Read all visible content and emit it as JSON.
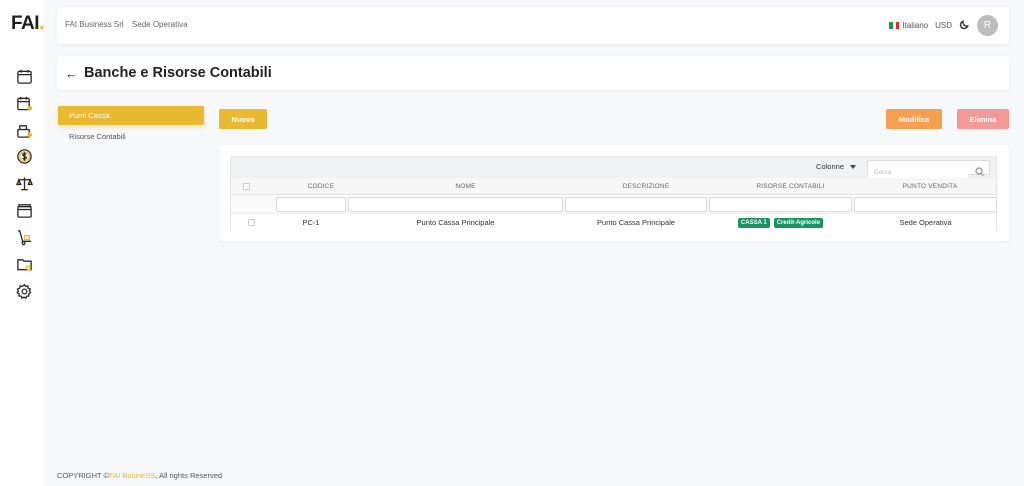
{
  "app": {
    "logo_text": "FAI",
    "logo_dot": ".",
    "brand_color": "#e8b931"
  },
  "sidebar": {
    "icons": [
      {
        "name": "calendar-icon"
      },
      {
        "name": "calendar-alert-icon"
      },
      {
        "name": "cash-register-icon"
      },
      {
        "name": "dollar-coin-icon"
      },
      {
        "name": "scale-icon"
      },
      {
        "name": "wallet-icon"
      },
      {
        "name": "hand-truck-icon"
      },
      {
        "name": "folder-search-icon"
      },
      {
        "name": "gear-icon"
      }
    ]
  },
  "header": {
    "company": "FAI.Business Srl",
    "location": "Sede Operativa",
    "language": "Italiano",
    "currency": "USD",
    "avatar_initial": "R"
  },
  "page": {
    "title": "Banche e Risorse Contabili"
  },
  "tabs": [
    {
      "label": "Punti Cassa",
      "active": true
    },
    {
      "label": "Risorse Contabili",
      "active": false
    }
  ],
  "buttons": {
    "new": "Nuovo",
    "edit": "Modifica",
    "delete": "Elimina"
  },
  "table": {
    "columns_label": "Colonne",
    "search_placeholder": "Cerca",
    "headers": [
      "CODICE",
      "NOME",
      "DESCRIZIONE",
      "RISORSE CONTABILI",
      "PUNTO VENDITA"
    ],
    "rows": [
      {
        "codice": "PC-1",
        "nome": "Punto Cassa Principale",
        "descrizione": "Punto Cassa Principale",
        "risorse": [
          "CASSA 1",
          "Credit-Agricole"
        ],
        "punto_vendita": "Sede Operativa"
      }
    ]
  },
  "footer": {
    "prefix": "COPYRIGHT ©",
    "brand": "FAI.BusineSS",
    "suffix": ", All rights Reserved"
  },
  "colors": {
    "primary": "#e8b931",
    "edit": "#f5a04f",
    "delete": "#f09a9a",
    "badge": "#1a9462"
  }
}
